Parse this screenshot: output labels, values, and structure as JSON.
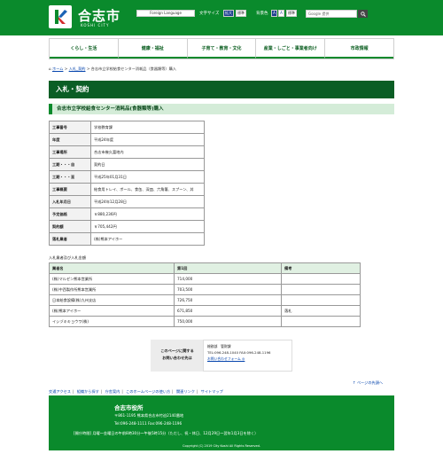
{
  "header": {
    "logo_name": "合志市",
    "logo_sub": "KOSHI CITY",
    "foreign_language": "Foreign Language",
    "text_size_label": "文字サイズ",
    "text_size_large": "拡大",
    "text_size_standard": "標準",
    "bg_color_label": "背景色",
    "bg_color_a1": "A",
    "bg_color_a2": "A",
    "bg_color_standard": "標準",
    "search_placeholder": "Google 提供",
    "accent": "#0a8a2c"
  },
  "nav": [
    "くらし・生活",
    "健康・福祉",
    "子育て・教育・文化",
    "産業・しごと・事業者向け",
    "市政情報"
  ],
  "breadcrumb": {
    "home": "ホーム",
    "level1": "入札_契約",
    "current": "合志市立学校給食センター消耗品（食器類等）購入"
  },
  "page_title": "入札・契約",
  "sub_title": "合志市立学校給食センター消耗品(食器類等)購入",
  "info_rows": [
    {
      "key": "工事番号",
      "value": "学校教育課"
    },
    {
      "key": "年度",
      "value": "平成24年度"
    },
    {
      "key": "工事場所",
      "value": "合志市幾久富地内"
    },
    {
      "key": "工期・・・自",
      "value": "契約日"
    },
    {
      "key": "工期・・・至",
      "value": "平成25年01月31日"
    },
    {
      "key": "工事概要",
      "value": "給食用トレイ、ボール、食缶、深皿、六角箸、スプーン、丼"
    },
    {
      "key": "入札年月日",
      "value": "平成24年12月28日"
    },
    {
      "key": "予定価格",
      "value": "￥880,236円"
    },
    {
      "key": "契約額",
      "value": "￥705,442円"
    },
    {
      "key": "落札業者",
      "value": "(株)熊本アイホー"
    }
  ],
  "bids": {
    "caption": "入札業者及び入札金額",
    "headers": [
      "業者名",
      "第1回",
      "備考"
    ],
    "rows": [
      [
        "(株)マルゼン熊本営業所",
        "714,000",
        ""
      ],
      [
        "(株)中西製作所熊本営業所",
        "703,500",
        ""
      ],
      [
        "日本給食設備(株)九州支店",
        "726,750",
        ""
      ],
      [
        "(株)熊本アイホー",
        "671,850",
        "落札"
      ],
      [
        "イシヅキキョウワ(株)",
        "750,000",
        ""
      ]
    ]
  },
  "contact": {
    "label_line1": "このページに関する",
    "label_line2": "お問い合わせ先は",
    "dept": "総務部　管財課",
    "tel": "TEL:096-248-1040 FAX:096-248-1196",
    "form_link": "お問い合わせフォーム ◎"
  },
  "page_top": "↑ ページの先頭へ",
  "footer_links": [
    "交通アクセス",
    "組織から探す",
    "庁舎案内",
    "このホームページの使い方",
    "関連リンク",
    "サイトマップ"
  ],
  "footer": {
    "title": "合志市役所",
    "address": "〒861-1195  熊本県合志市竹迫2140番地",
    "phone": "Tel:096-248-1111   Fax:096-248-1196",
    "hours": "[開庁時間] 月曜～金曜日の午前8時30分～午後5時15分（ただし、祝・休日、12月29日～翌年1月3日を除く）",
    "copyright": "Copyright (C) 2019 City Koshi All Rights Reserved."
  }
}
